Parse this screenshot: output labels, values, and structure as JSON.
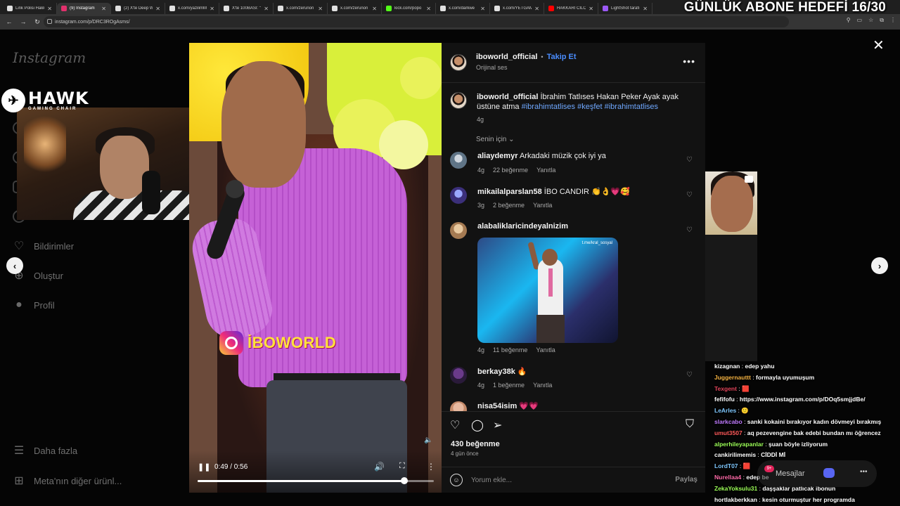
{
  "browser": {
    "tabs": [
      {
        "label": "Link Polisi Hakk",
        "color": "#e0e0e0",
        "active": false
      },
      {
        "label": "(9) Instagram",
        "color": "#e1306c",
        "active": true
      },
      {
        "label": "(2) X'te Deep W",
        "color": "#e0e0e0",
        "active": false
      },
      {
        "label": "x.com/yazilimM",
        "color": "#e0e0e0",
        "active": false
      },
      {
        "label": "X'te 100BASI: \"",
        "color": "#e0e0e0",
        "active": false
      },
      {
        "label": "x.com/zerunon",
        "color": "#e0e0e0",
        "active": false
      },
      {
        "label": "x.com/zerunon",
        "color": "#e0e0e0",
        "active": false
      },
      {
        "label": "kick.com/popo",
        "color": "#53fc18",
        "active": false
      },
      {
        "label": "x.com/darkwe",
        "color": "#e0e0e0",
        "active": false
      },
      {
        "label": "x.com/YETGAM",
        "color": "#e0e0e0",
        "active": false
      },
      {
        "label": "HAKKARİ CİLO",
        "color": "#ff0000",
        "active": false
      },
      {
        "label": "LightShot tarafı",
        "color": "#9b59f6",
        "active": false
      }
    ],
    "url": "instagram.com/p/DRC3ROgAsms/"
  },
  "stream_overlay": {
    "goal_text": "GÜNLÜK ABONE HEDEFİ 16/30",
    "brand_name": "HAWK",
    "brand_sub": "GAMING CHAIR"
  },
  "sidebar": {
    "logo": "Instagram",
    "items": [
      {
        "label": "Bildirimler",
        "icon": "heart-icon"
      },
      {
        "label": "Oluştur",
        "icon": "plus-icon"
      },
      {
        "label": "Profil",
        "icon": "profile-icon"
      },
      {
        "label": "Daha fazla",
        "icon": "menu-icon"
      },
      {
        "label": "Meta'nın diğer ürünl...",
        "icon": "grid-icon"
      }
    ]
  },
  "video": {
    "watermark": "İBOWORLD",
    "time": "0:49 / 0:56",
    "progress": 0.875
  },
  "post": {
    "author": "iboworld_official",
    "follow_label": "Takip Et",
    "audio": "Orijinal ses",
    "caption_author": "iboworld_official",
    "caption_text": "İbrahim Tatlıses Hakan Peker Ayak ayak üstüne atma",
    "caption_tags": "#ibrahimtatlises #keşfet #ibrahimtatlises",
    "caption_age": "4g",
    "sort_label": "Senin için",
    "comments": [
      {
        "user": "aliaydemyr",
        "text": "Arkadaki müzik çok iyi ya",
        "age": "4g",
        "likes": "22 beğenme",
        "reply": "Yanıtla"
      },
      {
        "user": "mikailalparslan58",
        "text": "İBO CANDIR 👏👌💗🥰",
        "age": "3g",
        "likes": "2 beğenme",
        "reply": "Yanıtla"
      },
      {
        "user": "alabaliklaricindeyalnizim",
        "text": "",
        "gif_watermark": "t.me/kral_sosyal",
        "age": "4g",
        "likes": "11 beğenme",
        "reply": "Yanıtla"
      },
      {
        "user": "berkay38k",
        "text": "🔥",
        "age": "4g",
        "likes": "1 beğenme",
        "reply": "Yanıtla"
      },
      {
        "user": "nisa54isim",
        "text": "💗💗",
        "age": "",
        "likes": "",
        "reply": ""
      }
    ],
    "likes": "430 beğenme",
    "date": "4 gün önce",
    "comment_placeholder": "Yorum ekle...",
    "share_label": "Paylaş"
  },
  "chat": {
    "lines": [
      {
        "user": "kizagnan",
        "color": "#ffffff",
        "msg": "edep yahu"
      },
      {
        "user": "Juggernauttt",
        "color": "#f5b342",
        "msg": "formayla uyumuşum"
      },
      {
        "user": "Texgent",
        "color": "#e0445a",
        "msg": "🟥"
      },
      {
        "user": "fefifofu",
        "color": "#ffffff",
        "msg": "https://www.instagram.com/p/DOq5smjjdBe/"
      },
      {
        "user": "LeArles",
        "color": "#7fc8ff",
        "msg": "🙂"
      },
      {
        "user": "slarkcabo",
        "color": "#c07bff",
        "msg": "sanki kokaini bırakıyor kadın dövmeyi bırakmış"
      },
      {
        "user": "umut3507",
        "color": "#ff5a5a",
        "msg": "aq pezevengine bak edebi bundan mı öğrencez"
      },
      {
        "user": "alperhileyapanlar",
        "color": "#9cff57",
        "msg": "şuan böyle izliyorum"
      },
      {
        "user": "cankirilimemis",
        "color": "#ffffff",
        "msg": "CİDDİ Mİ"
      },
      {
        "user": "LordT07",
        "color": "#7fc8ff",
        "msg": "🟥"
      },
      {
        "user": "Nurellaa4",
        "color": "#ff6aa8",
        "msg": "edep be"
      },
      {
        "user": "ZekaYoksulu31",
        "color": "#9cff57",
        "msg": "daşşaklar patlıcak ibonun"
      },
      {
        "user": "hortlakberkkan",
        "color": "#ffffff",
        "msg": "kesin oturmuştur her programda"
      }
    ],
    "messages_label": "Mesajlar",
    "badge": "9+"
  }
}
